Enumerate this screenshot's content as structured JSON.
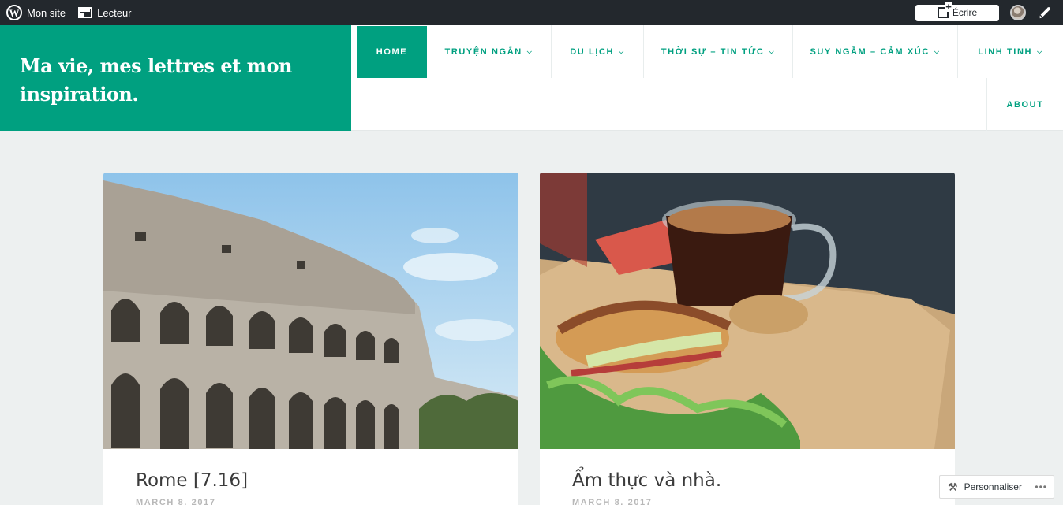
{
  "adminbar": {
    "my_site_label": "Mon site",
    "reader_label": "Lecteur",
    "write_label": "Écrire",
    "icons": [
      "wordpress-icon",
      "reader-icon",
      "write-icon",
      "avatar",
      "notifications-icon"
    ]
  },
  "site": {
    "title": "Ma vie, mes lettres et mon inspiration.",
    "brand_color": "#00a080"
  },
  "nav": {
    "items": [
      {
        "label": "HOME",
        "active": true
      },
      {
        "label": "TRUYỆN NGẮN",
        "has_dropdown": true
      },
      {
        "label": "DU LỊCH",
        "has_dropdown": true
      },
      {
        "label": "THỜI SỰ – TIN TỨC",
        "has_dropdown": true
      },
      {
        "label": "SUY NGẪM – CẢM XÚC",
        "has_dropdown": true
      },
      {
        "label": "LINH TINH",
        "has_dropdown": true
      },
      {
        "label": "ABOUT"
      }
    ]
  },
  "posts": [
    {
      "title": "Rome [7.16]",
      "date": "MARCH 8, 2017",
      "image": "colosseum-photo"
    },
    {
      "title": "Ẩm thực và nhà.",
      "date": "MARCH 8, 2017",
      "image": "coffee-sandwich-photo"
    }
  ],
  "customize": {
    "label": "Personnaliser"
  }
}
